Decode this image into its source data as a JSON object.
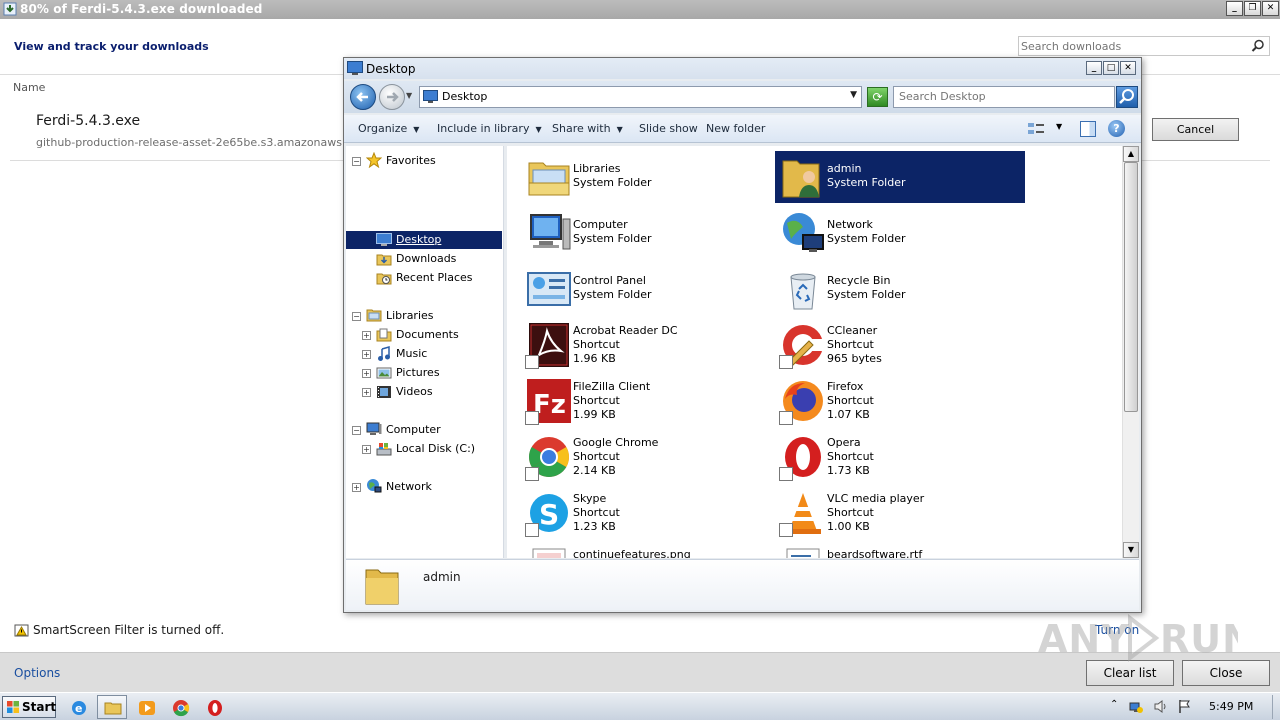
{
  "download_manager": {
    "title": "80% of Ferdi-5.4.3.exe downloaded",
    "subtitle": "View and track your downloads",
    "search_placeholder": "Search downloads",
    "column_name": "Name",
    "file": {
      "name": "Ferdi-5.4.3.exe",
      "source": "github-production-release-asset-2e65be.s3.amazonaws.com",
      "cancel_label": "Cancel"
    },
    "smartscreen_text": "SmartScreen Filter is turned off.",
    "turn_on_label": "Turn on",
    "options_label": "Options",
    "clear_list_label": "Clear list",
    "close_label": "Close"
  },
  "explorer": {
    "title": "Desktop",
    "address": "Desktop",
    "search_placeholder": "Search Desktop",
    "toolbar": {
      "organize": "Organize",
      "include_in_library": "Include in library",
      "share_with": "Share with",
      "slide_show": "Slide show",
      "new_folder": "New folder"
    },
    "nav": {
      "favorites": "Favorites",
      "desktop": "Desktop",
      "downloads": "Downloads",
      "recent_places": "Recent Places",
      "libraries": "Libraries",
      "documents": "Documents",
      "music": "Music",
      "pictures": "Pictures",
      "videos": "Videos",
      "computer": "Computer",
      "local_disk": "Local Disk (C:)",
      "network": "Network"
    },
    "items": [
      {
        "name": "Libraries",
        "type": "System Folder",
        "size": ""
      },
      {
        "name": "admin",
        "type": "System Folder",
        "size": ""
      },
      {
        "name": "Computer",
        "type": "System Folder",
        "size": ""
      },
      {
        "name": "Network",
        "type": "System Folder",
        "size": ""
      },
      {
        "name": "Control Panel",
        "type": "System Folder",
        "size": ""
      },
      {
        "name": "Recycle Bin",
        "type": "System Folder",
        "size": ""
      },
      {
        "name": "Acrobat Reader DC",
        "type": "Shortcut",
        "size": "1.96 KB"
      },
      {
        "name": "CCleaner",
        "type": "Shortcut",
        "size": "965 bytes"
      },
      {
        "name": "FileZilla Client",
        "type": "Shortcut",
        "size": "1.99 KB"
      },
      {
        "name": "Firefox",
        "type": "Shortcut",
        "size": "1.07 KB"
      },
      {
        "name": "Google Chrome",
        "type": "Shortcut",
        "size": "2.14 KB"
      },
      {
        "name": "Opera",
        "type": "Shortcut",
        "size": "1.73 KB"
      },
      {
        "name": "Skype",
        "type": "Shortcut",
        "size": "1.23 KB"
      },
      {
        "name": "VLC media player",
        "type": "Shortcut",
        "size": "1.00 KB"
      },
      {
        "name": "continuefeatures.png",
        "type": "",
        "size": ""
      },
      {
        "name": "beardsoftware.rtf",
        "type": "",
        "size": ""
      }
    ],
    "details_name": "admin"
  },
  "taskbar": {
    "start_label": "Start",
    "clock": "5:49 PM"
  },
  "colors": {
    "selection": "#0c2466",
    "link": "#1a4fa0"
  }
}
